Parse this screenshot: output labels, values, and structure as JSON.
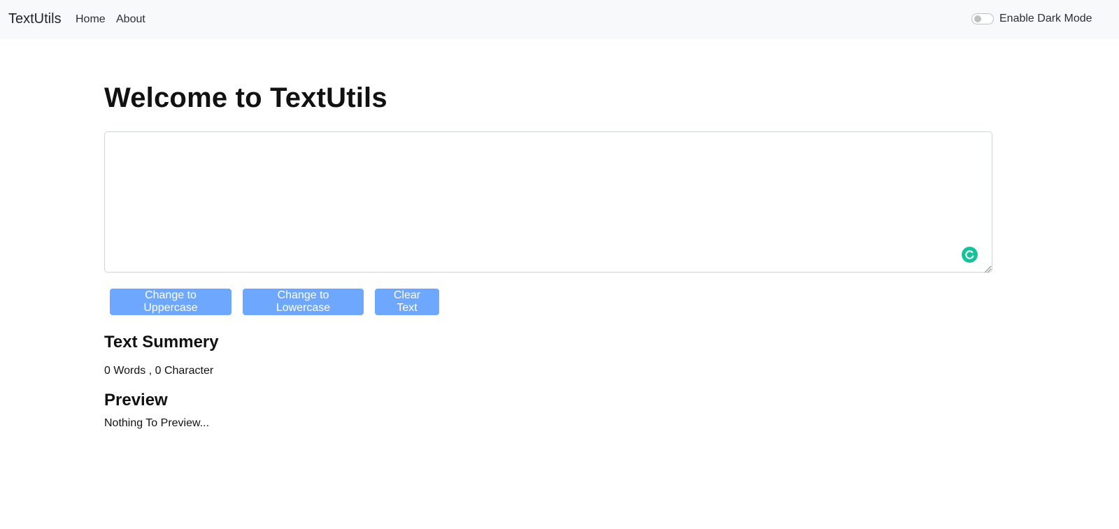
{
  "navbar": {
    "brand": "TextUtils",
    "links": [
      {
        "label": "Home"
      },
      {
        "label": "About"
      }
    ],
    "dark_mode": {
      "label": "Enable Dark Mode",
      "enabled": false
    }
  },
  "main": {
    "heading": "Welcome to TextUtils",
    "textarea": {
      "value": ""
    },
    "buttons": {
      "uppercase": "Change to Uppercase",
      "lowercase": "Change to Lowercase",
      "clear": "Clear Text"
    },
    "summary": {
      "title": "Text Summery",
      "text": "0 Words , 0 Character"
    },
    "preview": {
      "title": "Preview",
      "text": "Nothing To Preview..."
    }
  },
  "colors": {
    "navbar_bg": "#f8f9fa",
    "button_bg": "#6ea8fe",
    "grammar_icon": "#15c39a"
  },
  "icons": {
    "grammar": "grammarly-icon",
    "resize": "resize-grip-icon"
  }
}
